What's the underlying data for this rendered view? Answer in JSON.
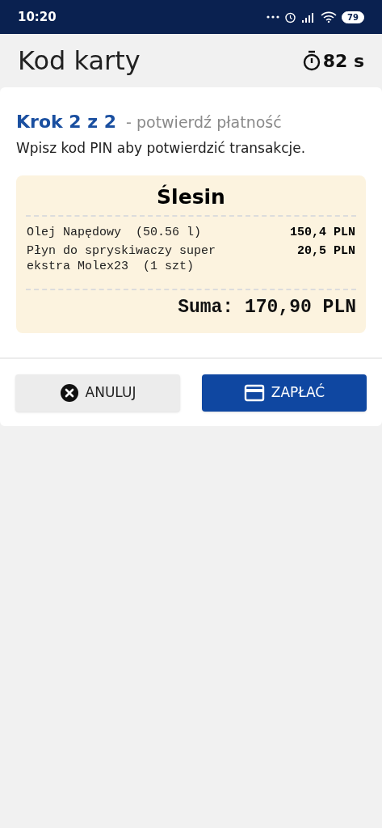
{
  "status_bar": {
    "time": "10:20",
    "battery": "79"
  },
  "header": {
    "title": "Kod karty",
    "timer": "82 s"
  },
  "step": {
    "label": "Krok 2 z 2",
    "subtitle": "- potwierdź płatność",
    "instruction": "Wpisz kod PIN aby potwierdzić transakcje."
  },
  "receipt": {
    "station": "Ślesin",
    "items": [
      {
        "name": "Olej Napędowy  (50.56 l)",
        "price": "150,4 PLN"
      },
      {
        "name": "Płyn do spryskiwaczy super ekstra Molex23  (1 szt)",
        "price": "20,5 PLN"
      }
    ],
    "total": "Suma: 170,90 PLN"
  },
  "buttons": [
    {
      "kind": "cancel",
      "label": "ANULUJ"
    },
    {
      "kind": "pay",
      "label": "ZAPŁAĆ"
    }
  ]
}
